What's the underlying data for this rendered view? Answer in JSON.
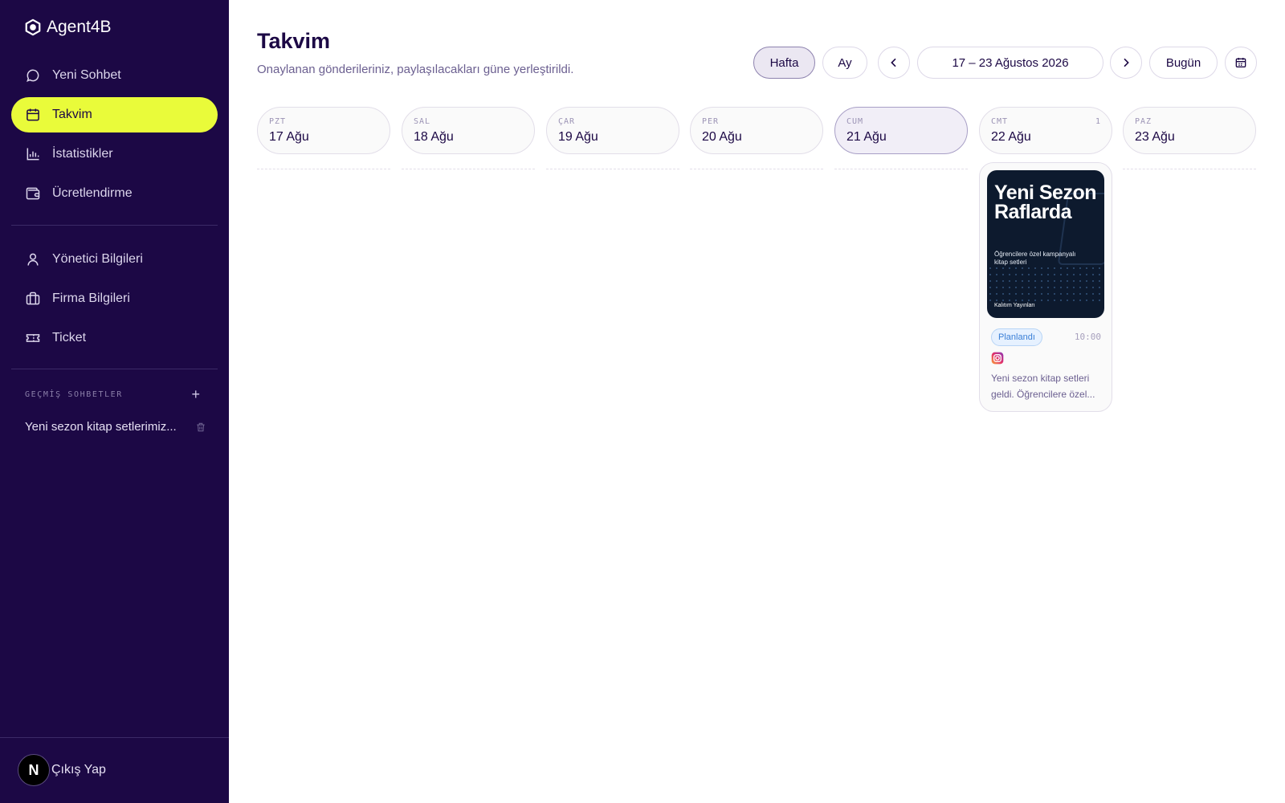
{
  "brand": {
    "name": "Agent4B"
  },
  "sidebar": {
    "primary": [
      {
        "label": "Yeni Sohbet",
        "icon": "chat-bubble-icon"
      },
      {
        "label": "Takvim",
        "icon": "calendar-icon",
        "active": true
      },
      {
        "label": "İstatistikler",
        "icon": "bar-chart-icon"
      },
      {
        "label": "Ücretlendirme",
        "icon": "wallet-icon"
      }
    ],
    "secondary": [
      {
        "label": "Yönetici Bilgileri",
        "icon": "user-icon"
      },
      {
        "label": "Firma Bilgileri",
        "icon": "briefcase-icon"
      },
      {
        "label": "Ticket",
        "icon": "ticket-icon"
      }
    ],
    "history_title": "GEÇMİŞ SOHBETLER",
    "history_items": [
      {
        "label": "Yeni sezon kitap setlerimiz..."
      }
    ],
    "avatar_letter": "N",
    "logout_label": "Çıkış Yap"
  },
  "header": {
    "title": "Takvim",
    "subtitle": "Onaylanan gönderileriniz, paylaşılacakları güne yerleştirildi.",
    "view_week": "Hafta",
    "view_month": "Ay",
    "range": "17 – 23 Ağustos 2026",
    "today": "Bugün"
  },
  "days": [
    {
      "dow": "PZT",
      "date": "17 Ağu",
      "count": ""
    },
    {
      "dow": "SAL",
      "date": "18 Ağu",
      "count": ""
    },
    {
      "dow": "ÇAR",
      "date": "19 Ağu",
      "count": ""
    },
    {
      "dow": "PER",
      "date": "20 Ağu",
      "count": ""
    },
    {
      "dow": "CUM",
      "date": "21 Ağu",
      "count": "",
      "today": true
    },
    {
      "dow": "CMT",
      "date": "22 Ağu",
      "count": "1"
    },
    {
      "dow": "PAZ",
      "date": "23 Ağu",
      "count": ""
    }
  ],
  "post": {
    "poster_headline": "Yeni Sezon Raflarda",
    "poster_tagline": "Öğrencilere özel kampanyalı kitap setleri",
    "poster_brand": "Kalıtım Yayınları",
    "status": "Planlandı",
    "time": "10:00",
    "platform": "instagram-icon",
    "caption_line1": "Yeni sezon kitap setleri",
    "caption_line2": "geldi. Öğrencilere özel..."
  },
  "colors": {
    "sidebar_bg": "#1c0845",
    "active_accent": "#e9fb3a",
    "status_blue": "#3a7fd6"
  }
}
